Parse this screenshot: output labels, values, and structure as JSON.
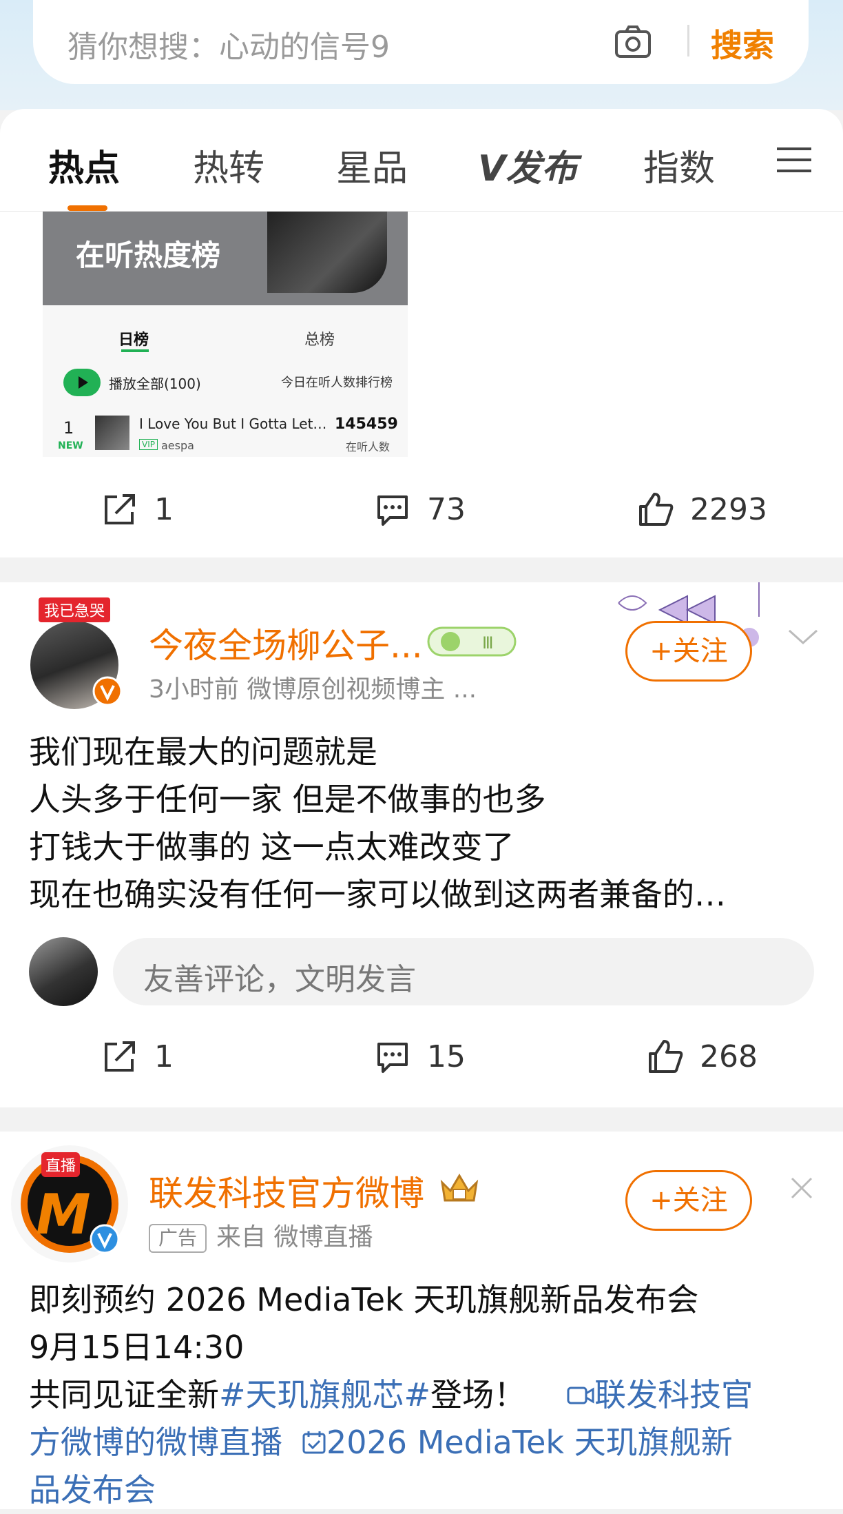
{
  "search": {
    "placeholder": "猜你想搜：心动的信号9",
    "button": "搜索"
  },
  "tabs": [
    "热点",
    "热转",
    "星品",
    "V发布",
    "指数"
  ],
  "post1": {
    "image": {
      "title": "在听热度榜",
      "tab_day": "日榜",
      "tab_total": "总榜",
      "play_all": "播放全部(100)",
      "ranking_label": "今日在听人数排行榜",
      "rank": "1",
      "new_tag": "NEW",
      "song": "I Love You But I Gotta Let…",
      "vip": "VIP",
      "artist": "aespa",
      "count": "145459",
      "count_label": "在听人数"
    },
    "reposts": "1",
    "comments": "73",
    "likes": "2293"
  },
  "post2": {
    "badge": "我已急哭",
    "username": "今夜全场柳公子...",
    "meta": "3小时前  微博原创视频博主 ...",
    "follow": "+关注",
    "lines": [
      "我们现在最大的问题就是",
      "人头多于任何一家 但是不做事的也多",
      "打钱大于做事的 这一点太难改变了",
      "现在也确实没有任何一家可以做到这两者兼备的…"
    ],
    "comment_placeholder": "友善评论，文明发言",
    "reposts": "1",
    "comments": "15",
    "likes": "268"
  },
  "post3": {
    "live_badge": "直播",
    "username": "联发科技官方微博",
    "ad_tag": "广告",
    "source": "来自 微博直播",
    "follow": "+关注",
    "line1": "即刻预约 2026 MediaTek 天玑旗舰新品发布会",
    "line2": "9月15日14:30",
    "line3_prefix": "共同见证全新",
    "hashtag": "#天玑旗舰芯#",
    "line3_suffix": "登场！",
    "link1_a": "联发科技官",
    "link1_b": "方微博的微博直播",
    "link2_a": "2026 MediaTek 天玑旗舰新",
    "link2_b": "品发布会"
  }
}
